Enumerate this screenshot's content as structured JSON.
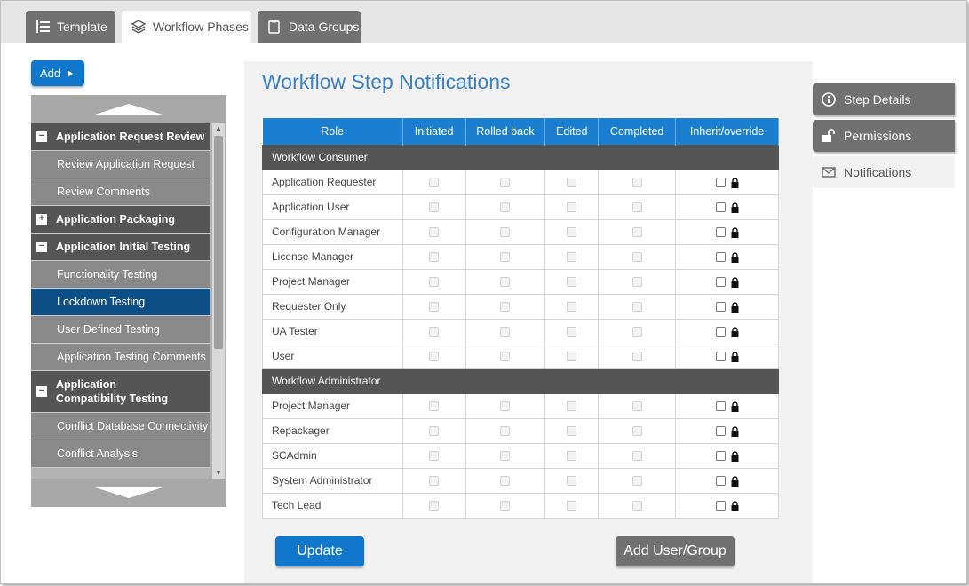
{
  "tabs": [
    {
      "label": "Template",
      "icon": "list-icon",
      "active": false
    },
    {
      "label": "Workflow Phases",
      "icon": "layers-icon",
      "active": true
    },
    {
      "label": "Data Groups",
      "icon": "clipboard-icon",
      "active": false
    }
  ],
  "left_panel": {
    "add_label": "Add",
    "tree": [
      {
        "type": "group",
        "label": "Application Request Review",
        "expanded": true
      },
      {
        "type": "child",
        "label": "Review Application Request"
      },
      {
        "type": "child",
        "label": "Review Comments"
      },
      {
        "type": "group",
        "label": "Application Packaging",
        "expanded": false
      },
      {
        "type": "group",
        "label": "Application Initial Testing",
        "expanded": true
      },
      {
        "type": "child",
        "label": "Functionality Testing"
      },
      {
        "type": "child",
        "label": "Lockdown Testing",
        "selected": true
      },
      {
        "type": "child",
        "label": "User Defined Testing"
      },
      {
        "type": "child",
        "label": "Application Testing Comments"
      },
      {
        "type": "group",
        "label": "Application Compatibility Testing",
        "expanded": true
      },
      {
        "type": "child",
        "label": "Conflict Database Connectivity"
      },
      {
        "type": "child",
        "label": "Conflict Analysis"
      }
    ]
  },
  "main": {
    "title": "Workflow Step Notifications",
    "columns": [
      "Role",
      "Initiated",
      "Rolled back",
      "Edited",
      "Completed",
      "Inherit/override"
    ],
    "sections": [
      {
        "name": "Workflow Consumer",
        "roles": [
          "Application Requester",
          "Application User",
          "Configuration Manager",
          "License Manager",
          "Project Manager",
          "Requester Only",
          "UA Tester",
          "User"
        ]
      },
      {
        "name": "Workflow Administrator",
        "roles": [
          "Project Manager",
          "Repackager",
          "SCAdmin",
          "System Administrator",
          "Tech Lead"
        ]
      }
    ],
    "update_label": "Update",
    "add_user_group_label": "Add User/Group"
  },
  "side_tabs": [
    {
      "label": "Step Details",
      "icon": "info-icon",
      "active": false
    },
    {
      "label": "Permissions",
      "icon": "unlock-icon",
      "active": false
    },
    {
      "label": "Notifications",
      "icon": "envelope-icon",
      "active": true
    }
  ],
  "colors": {
    "accent": "#1a7fd1",
    "dark_gray": "#555555",
    "selected": "#0d4f84",
    "title": "#3a7fc1"
  }
}
